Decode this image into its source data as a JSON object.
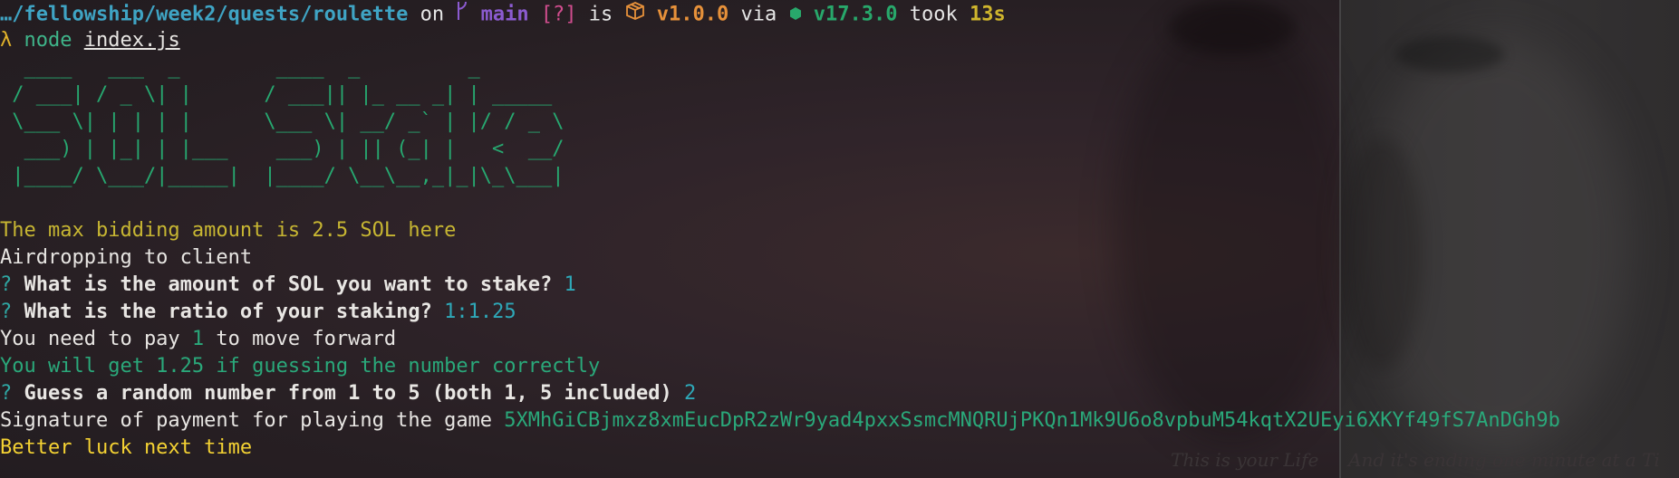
{
  "prompt": {
    "path": "…/fellowship/week2/quests/roulette",
    "on": " on ",
    "branch_icon": "git-branch-icon",
    "branch": "main",
    "status": "[?]",
    "is": " is ",
    "package_icon": "package-icon",
    "version": "v1.0.0",
    "via": " via ",
    "node_icon": "node-icon",
    "node_version": "v17.3.0",
    "took": " took ",
    "duration": "13s"
  },
  "command": {
    "symbol": "λ",
    "name": "node",
    "arg": "index.js"
  },
  "ascii_art": [
    "  ____   ___  _        ____  _         _",
    " / ___| / _ \\| |      / ___|| |_ __ _| | _____",
    " \\___ \\| | | | |      \\___ \\| __/ _` | |/ / _ \\",
    "  ___) | |_| | |___    ___) | || (_| |   <  __/",
    " |____/ \\___/|_____|  |____/ \\__\\__,_|_|\\_\\___|"
  ],
  "output": {
    "max_bid": "The max bidding amount is 2.5 SOL here",
    "airdrop": "Airdropping to client",
    "q1_mark": "?",
    "q1_text": "What is the amount of SOL you want to stake?",
    "q1_answer": "1",
    "q2_mark": "?",
    "q2_text": "What is the ratio of your staking?",
    "q2_answer": "1:1.25",
    "pay_prefix": "You need to pay ",
    "pay_amount": "1",
    "pay_suffix": " to move forward",
    "will_get": "You will get 1.25 if guessing the number correctly",
    "q3_mark": "?",
    "q3_text": "Guess a random number from 1 to 5 (both 1, 5 included)",
    "q3_answer": "2",
    "sig_prefix": "Signature of payment for playing the game ",
    "signature": "5XMhGiCBjmxz8xmEucDpR2zWr9yad4pxxSsmcMNQRUjPKQn1Mk9U6o8vpbuM54kqtX2UEyi6XKYf49fS7AnDGh9b",
    "result": "Better luck next time"
  },
  "wallpaper": {
    "quote_left": "This is your Life",
    "quote_right": "And it's ending one minute at a Ti"
  },
  "colors": {
    "background": "#2a2124",
    "path": "#3fa4c4",
    "branch": "#8b5bd0",
    "status": "#d14d8e",
    "version": "#e7913a",
    "node": "#28a86b",
    "duration": "#cfb52d",
    "art": "#27a870",
    "info_yellow": "#c7b632",
    "success_green": "#2aa87a",
    "answer_cyan": "#2ea8b8",
    "result_yellow": "#f4d233"
  }
}
